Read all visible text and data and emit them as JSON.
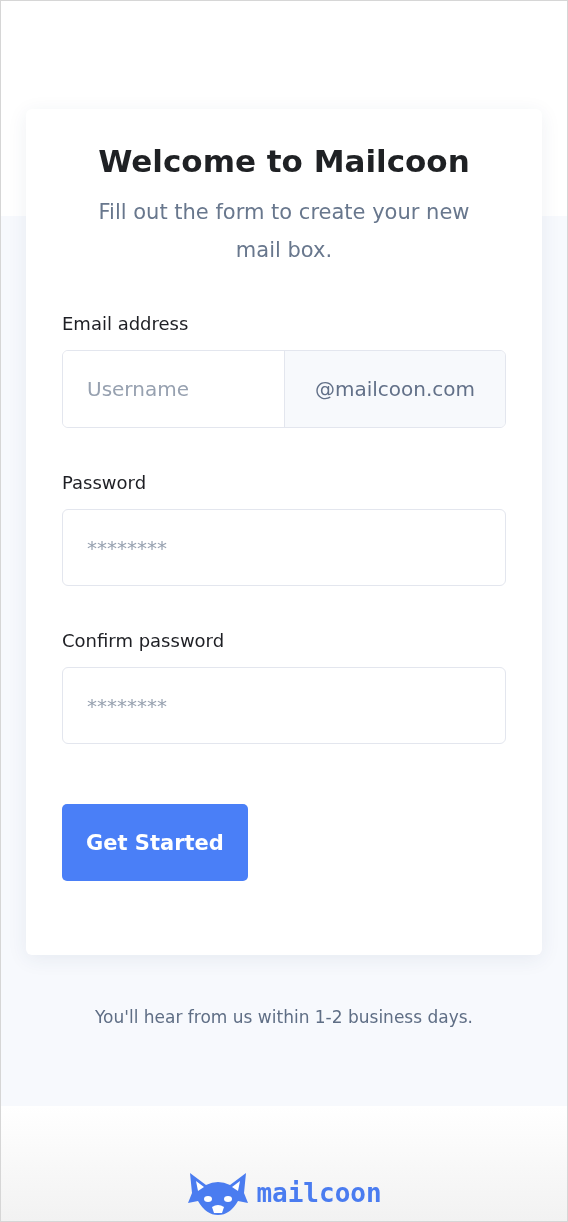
{
  "title": "Welcome to Mailcoon",
  "subtitle": "Fill out the form to create your new mail box.",
  "fields": [
    {
      "kind": "email",
      "label": "Email address",
      "placeholder": "Username",
      "suffix": "@mailcoon.com"
    },
    {
      "kind": "password",
      "label": "Password",
      "placeholder": "********"
    },
    {
      "kind": "password",
      "label": "Confirm password",
      "placeholder": "********"
    }
  ],
  "button": "Get Started",
  "note": "You'll hear from us within 1-2 business days.",
  "logo_text": "mailcoon"
}
